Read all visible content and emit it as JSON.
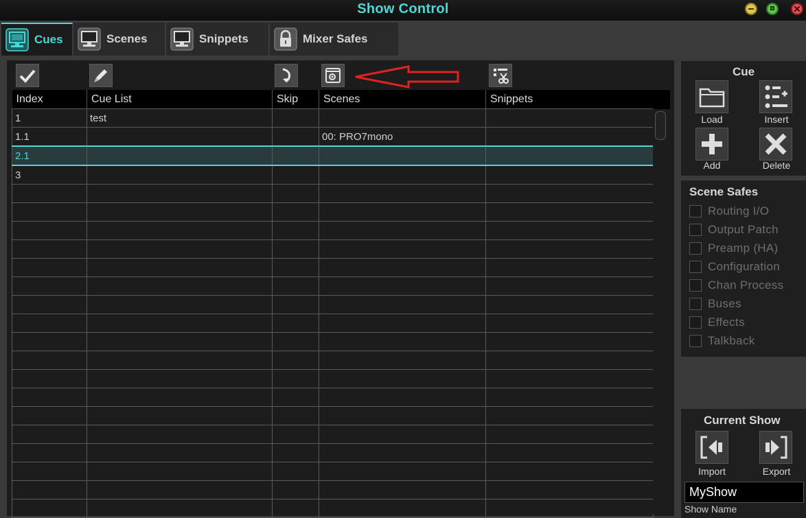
{
  "window": {
    "title": "Show Control"
  },
  "tabs": [
    {
      "label": "Cues",
      "icon": "monitor-icon"
    },
    {
      "label": "Scenes",
      "icon": "monitor-icon"
    },
    {
      "label": "Snippets",
      "icon": "monitor-icon"
    },
    {
      "label": "Mixer Safes",
      "icon": "lock-icon"
    }
  ],
  "table": {
    "columns": [
      "Index",
      "Cue List",
      "Skip",
      "Scenes",
      "Snippets"
    ],
    "rows": [
      {
        "index": "1",
        "cue_list": "test",
        "skip": "",
        "scenes": "",
        "snippets": ""
      },
      {
        "index": "1.1",
        "cue_list": "",
        "skip": "",
        "scenes": "00: PRO7mono",
        "snippets": ""
      },
      {
        "index": "2.1",
        "cue_list": "",
        "skip": "",
        "scenes": "",
        "snippets": ""
      },
      {
        "index": "3",
        "cue_list": "",
        "skip": "",
        "scenes": "",
        "snippets": ""
      }
    ]
  },
  "cue_panel": {
    "title": "Cue",
    "load": "Load",
    "insert": "Insert",
    "add": "Add",
    "delete": "Delete"
  },
  "scene_safes": {
    "title": "Scene Safes",
    "items": [
      "Routing I/O",
      "Output Patch",
      "Preamp (HA)",
      "Configuration",
      "Chan Process",
      "Buses",
      "Effects",
      "Talkback"
    ]
  },
  "current_show": {
    "title": "Current Show",
    "import": "Import",
    "export": "Export",
    "show_name": "MyShow",
    "show_name_label": "Show Name"
  },
  "colors": {
    "accent": "#4dd8d8",
    "annotation_arrow": "#e0231f",
    "panel": "#1c1c1c"
  }
}
